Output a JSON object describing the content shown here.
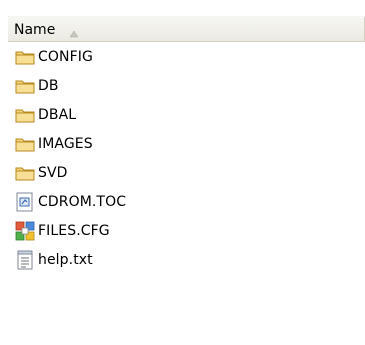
{
  "header": {
    "name_label": "Name"
  },
  "files": [
    {
      "name": "CONFIG",
      "type": "folder"
    },
    {
      "name": "DB",
      "type": "folder"
    },
    {
      "name": "DBAL",
      "type": "folder"
    },
    {
      "name": "IMAGES",
      "type": "folder"
    },
    {
      "name": "SVD",
      "type": "folder"
    },
    {
      "name": "CDROM.TOC",
      "type": "toc-file"
    },
    {
      "name": "FILES.CFG",
      "type": "config-file"
    },
    {
      "name": "help.txt",
      "type": "text-file"
    }
  ],
  "icons": {
    "folder": "folder-icon",
    "toc-file": "toc-file-icon",
    "config-file": "config-file-icon",
    "text-file": "text-file-icon",
    "sort": "sort-ascending-icon"
  },
  "colors": {
    "folder_fill": "#f2d27a",
    "folder_stroke": "#b88a1e",
    "header_border": "#d5d2c5"
  }
}
